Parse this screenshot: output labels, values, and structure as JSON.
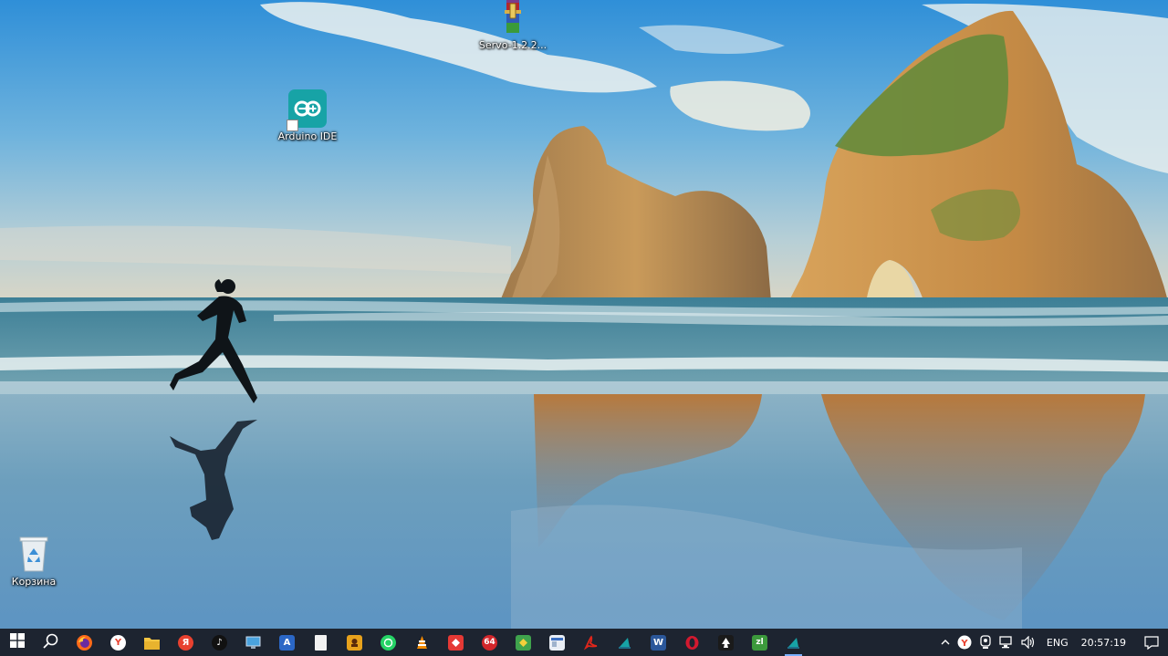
{
  "desktop": {
    "icons": [
      {
        "label": "Servo-1.2.2...",
        "icon": "winrar-archive-icon"
      },
      {
        "label": "Arduino IDE",
        "icon": "arduino-icon"
      },
      {
        "label": "Корзина",
        "icon": "recycle-bin-icon"
      }
    ]
  },
  "taskbar": {
    "start_icon": "windows-logo-icon",
    "search_icon": "search-icon",
    "apps": [
      {
        "name": "firefox",
        "glyph": "",
        "color": "#ff6a1a"
      },
      {
        "name": "yandex-browser",
        "glyph": "Y",
        "color": "#ffffff"
      },
      {
        "name": "file-explorer",
        "glyph": "",
        "color": "#f5c542"
      },
      {
        "name": "yandex",
        "glyph": "Я",
        "color": "#e8412f"
      },
      {
        "name": "tiktok",
        "glyph": "♪",
        "color": "#111111"
      },
      {
        "name": "remote-desktop",
        "glyph": "",
        "color": "#4aa3df"
      },
      {
        "name": "text-editor",
        "glyph": "A",
        "color": "#2b67c6"
      },
      {
        "name": "notepad",
        "glyph": "",
        "color": "#f2f2f2"
      },
      {
        "name": "image-app",
        "glyph": "",
        "color": "#e8a21c"
      },
      {
        "name": "whatsapp",
        "glyph": "",
        "color": "#25d366"
      },
      {
        "name": "vlc",
        "glyph": "",
        "color": "#f28a00"
      },
      {
        "name": "anydesk",
        "glyph": "",
        "color": "#e53935"
      },
      {
        "name": "aida64",
        "glyph": "64",
        "color": "#d3262b"
      },
      {
        "name": "calculator",
        "glyph": "",
        "color": "#3fa34d"
      },
      {
        "name": "window-app",
        "glyph": "",
        "color": "#e9eef5"
      },
      {
        "name": "acrobat",
        "glyph": "",
        "color": "#d7261b"
      },
      {
        "name": "arduino-ide",
        "glyph": "",
        "color": "#17a3a6"
      },
      {
        "name": "word",
        "glyph": "W",
        "color": "#2b579a"
      },
      {
        "name": "opera",
        "glyph": "O",
        "color": "#d3192f"
      },
      {
        "name": "inkscape",
        "glyph": "",
        "color": "#1a1a1a"
      },
      {
        "name": "zl-app",
        "glyph": "zl",
        "color": "#3c9a3c"
      },
      {
        "name": "arduino-ide-running",
        "glyph": "",
        "color": "#17a3a6"
      }
    ],
    "tray": {
      "chevron": "chevron-up-icon",
      "language": "ENG",
      "time": "20:57:19"
    }
  }
}
